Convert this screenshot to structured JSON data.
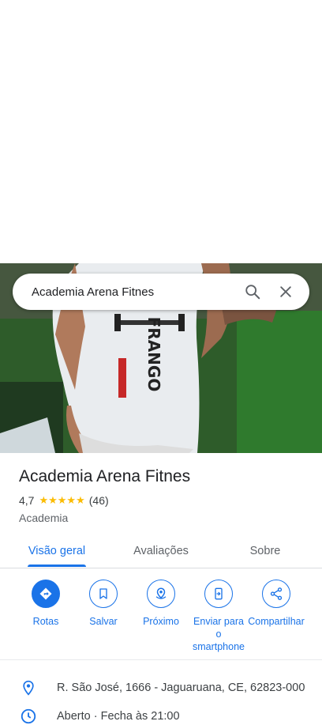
{
  "search": {
    "value": "Academia Arena Fitnes",
    "search_icon": "search-icon",
    "close_icon": "close-icon"
  },
  "place": {
    "name": "Academia Arena Fitnes",
    "rating": "4,7",
    "stars": 4.7,
    "stars_glyphs": "★★★★★",
    "reviews_count": "(46)",
    "category": "Academia"
  },
  "tabs": [
    {
      "label": "Visão geral",
      "active": true
    },
    {
      "label": "Avaliações",
      "active": false
    },
    {
      "label": "Sobre",
      "active": false
    }
  ],
  "actions": [
    {
      "label": "Rotas",
      "icon": "directions-icon"
    },
    {
      "label": "Salvar",
      "icon": "bookmark-icon"
    },
    {
      "label": "Próximo",
      "icon": "nearby-icon"
    },
    {
      "label": "Enviar para o smartphone",
      "icon": "send-to-phone-icon"
    },
    {
      "label": "Compartilhar",
      "icon": "share-icon"
    }
  ],
  "info": {
    "address": "R. São José, 1666 - Jaguaruana, CE, 62823-000",
    "hours_partial": "Aberto · Fecha às 21:00"
  },
  "colors": {
    "accent": "#1a73e8",
    "star": "#fbbc04"
  }
}
